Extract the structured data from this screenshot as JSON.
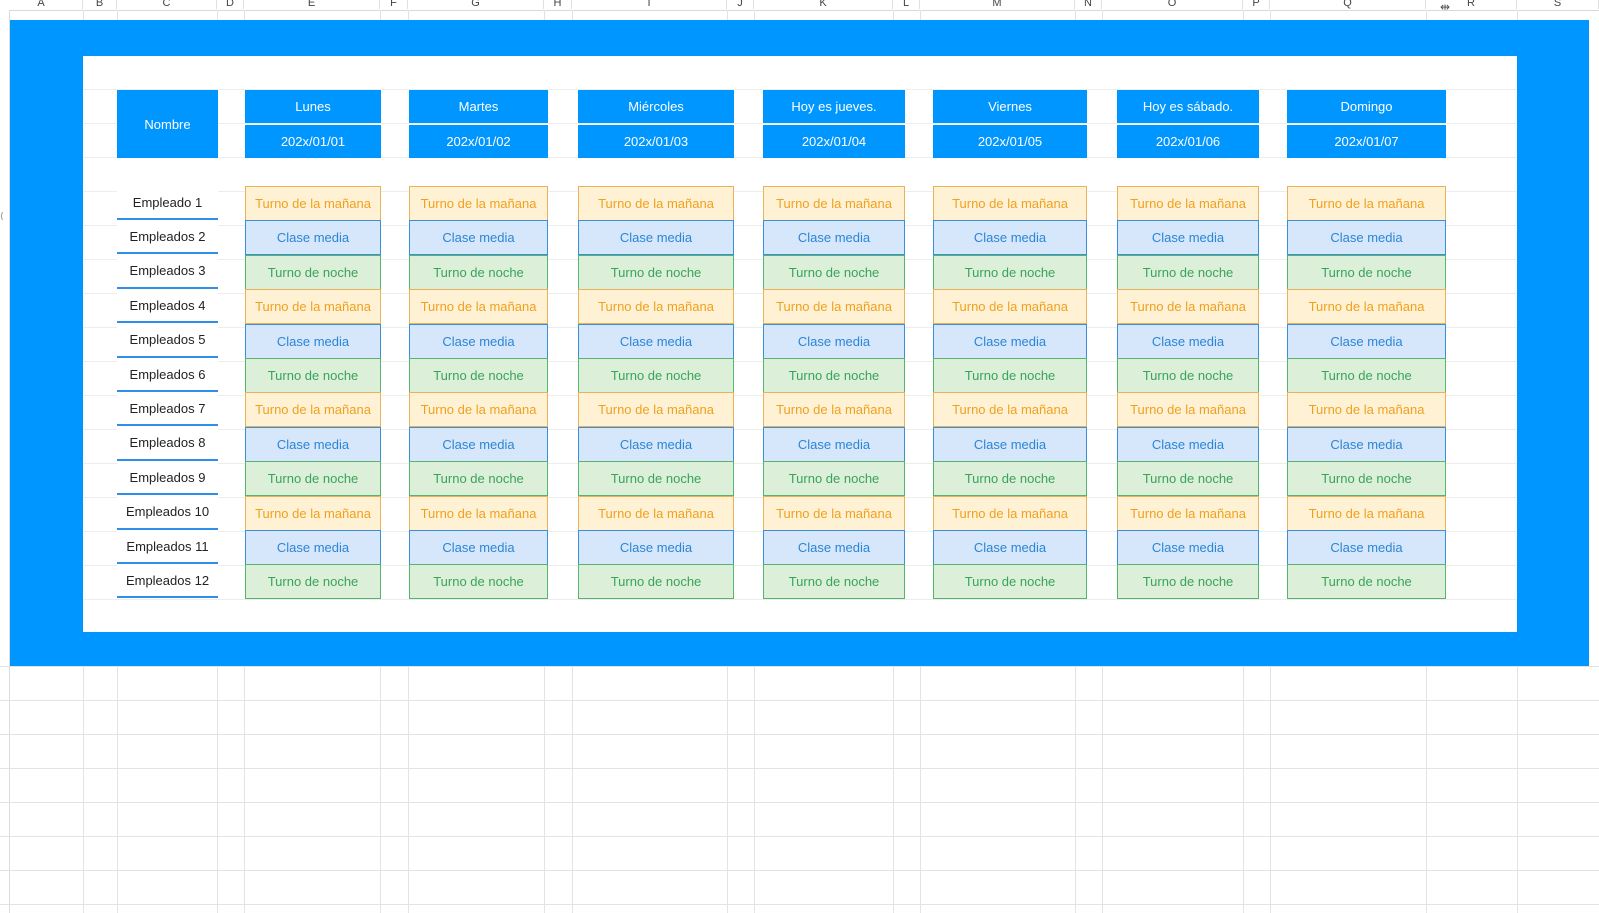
{
  "sheet": {
    "columns": [
      "A",
      "B",
      "C",
      "D",
      "E",
      "F",
      "G",
      "H",
      "I",
      "J",
      "K",
      "L",
      "M",
      "N",
      "O",
      "P",
      "Q",
      "R",
      "S"
    ],
    "header_name": "Nombre",
    "days": [
      {
        "label": "Lunes",
        "date": "202x/01/01"
      },
      {
        "label": "Martes",
        "date": "202x/01/02"
      },
      {
        "label": "Miércoles",
        "date": "202x/01/03"
      },
      {
        "label": "Hoy es jueves.",
        "date": "202x/01/04"
      },
      {
        "label": "Viernes",
        "date": "202x/01/05"
      },
      {
        "label": "Hoy es sábado.",
        "date": "202x/01/06"
      },
      {
        "label": "Domingo",
        "date": "202x/01/07"
      }
    ],
    "employees": [
      {
        "name": "Empleado 1",
        "shift": "morning"
      },
      {
        "name": "Empleados 2",
        "shift": "mid"
      },
      {
        "name": "Empleados 3",
        "shift": "night"
      },
      {
        "name": "Empleados 4",
        "shift": "morning"
      },
      {
        "name": "Empleados 5",
        "shift": "mid"
      },
      {
        "name": "Empleados 6",
        "shift": "night"
      },
      {
        "name": "Empleados 7",
        "shift": "morning"
      },
      {
        "name": "Empleados 8",
        "shift": "mid"
      },
      {
        "name": "Empleados 9",
        "shift": "night"
      },
      {
        "name": "Empleados 10",
        "shift": "morning"
      },
      {
        "name": "Empleados 11",
        "shift": "mid"
      },
      {
        "name": "Empleados 12",
        "shift": "night"
      }
    ],
    "shifts": {
      "morning": "Turno de la mañana",
      "mid": "Clase media",
      "night": "Turno de noche"
    }
  },
  "colors": {
    "accent": "#0096ff",
    "morning_bg": "#fff2d4",
    "morning_text": "#f0a020",
    "mid_bg": "#d6e6fb",
    "mid_text": "#2b86d6",
    "night_bg": "#dcefd9",
    "night_text": "#3aa35b"
  },
  "icons": {
    "column_resize": "column-resize-icon"
  }
}
